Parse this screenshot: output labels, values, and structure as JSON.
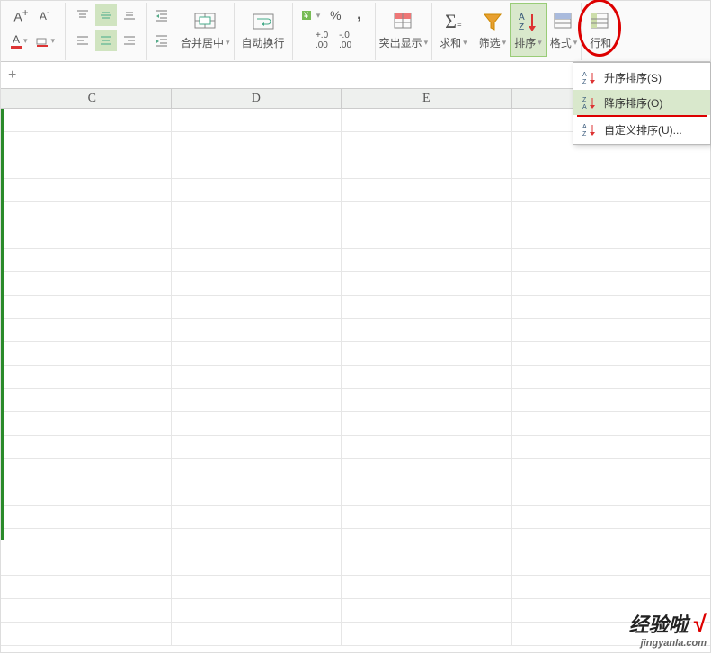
{
  "ribbon": {
    "merge_label": "合并居中",
    "wrap_label": "自动换行",
    "percent": "%",
    "comma": ",",
    "inc_dec": ".0",
    "inc_dec2": ".00",
    "highlight_label": "突出显示",
    "sum_label": "求和",
    "filter_label": "筛选",
    "sort_label": "排序",
    "format_label": "格式",
    "rowscols_label": "行和"
  },
  "dropdown": {
    "asc": "升序排序(S)",
    "desc": "降序排序(O)",
    "custom": "自定义排序(U)..."
  },
  "formula_bar": "+",
  "columns": {
    "b_stub": "",
    "c": "C",
    "d": "D",
    "e": "E",
    "f": ""
  },
  "watermark": {
    "line1": "经验啦",
    "check": "√",
    "line2": "jingyanla.com"
  }
}
